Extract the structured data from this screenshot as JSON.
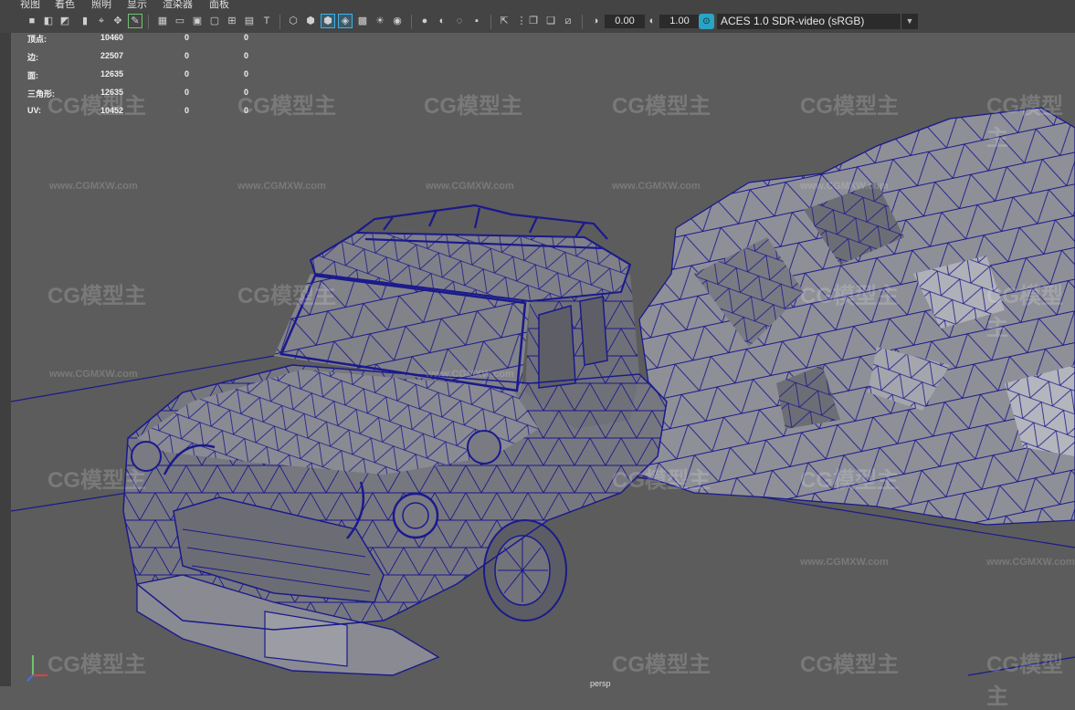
{
  "menu": {
    "items": [
      "视图",
      "着色",
      "照明",
      "显示",
      "渲染器",
      "面板"
    ]
  },
  "toolbar": {
    "exposure_value": "0.00",
    "gamma_value": "1.00",
    "color_space": "ACES 1.0 SDR-video (sRGB)"
  },
  "hud": {
    "rows": [
      {
        "label": "顶点:",
        "v1": "10460",
        "v2": "0",
        "v3": "0"
      },
      {
        "label": "边:",
        "v1": "22507",
        "v2": "0",
        "v3": "0"
      },
      {
        "label": "面:",
        "v1": "12635",
        "v2": "0",
        "v3": "0"
      },
      {
        "label": "三角形:",
        "v1": "12635",
        "v2": "0",
        "v3": "0"
      },
      {
        "label": "UV:",
        "v1": "10452",
        "v2": "0",
        "v3": "0"
      }
    ]
  },
  "watermark": {
    "logo": "CG模型主",
    "url": "www.CGMXW.com"
  },
  "camera_label": "persp",
  "colors": {
    "wire": "#1a1a8c",
    "mesh_light": "#9a9aa2",
    "mesh_dark": "#6e6e76",
    "viewport_bg": "#5c5c5c"
  }
}
